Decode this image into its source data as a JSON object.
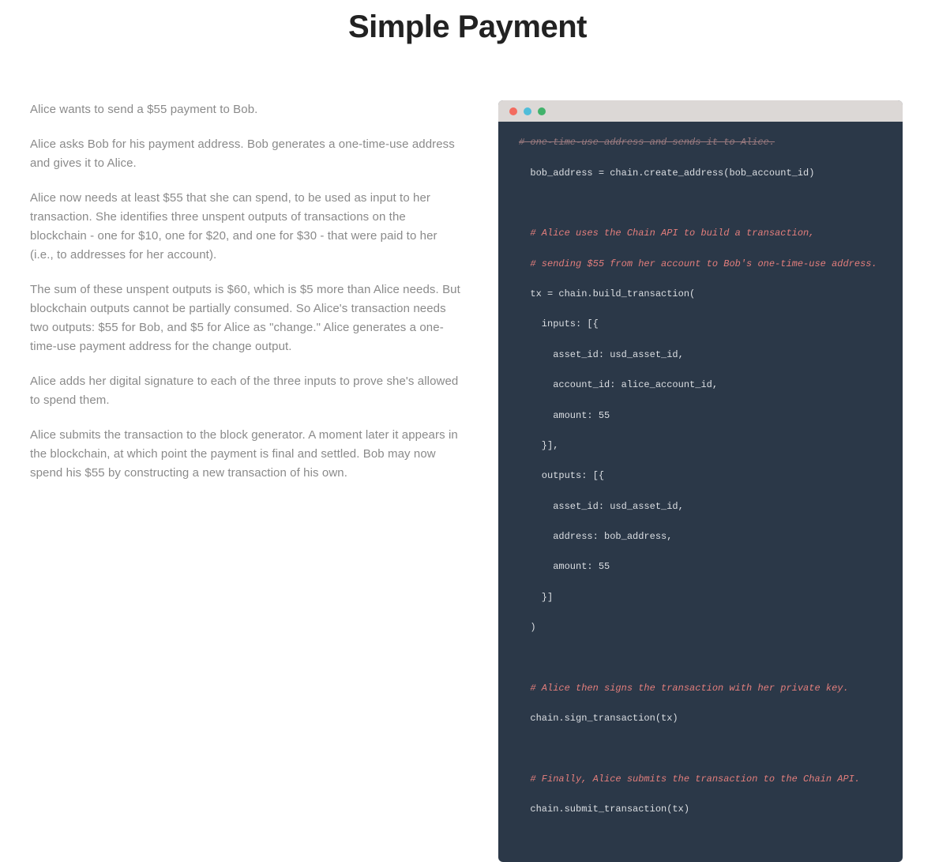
{
  "title": "Simple Payment",
  "paragraphs": [
    "Alice wants to send a $55 payment to Bob.",
    "Alice asks Bob for his payment address. Bob generates a one-time-use address and gives it to Alice.",
    "Alice now needs at least $55 that she can spend, to be used as input to her transaction. She identifies three unspent outputs of transactions on the blockchain - one for $10, one for $20, and one for $30 - that were paid to her (i.e., to addresses for her account).",
    "The sum of these unspent outputs is $60, which is $5 more than Alice needs. But blockchain outputs cannot be partially consumed. So Alice's transaction needs two outputs: $55 for Bob, and $5 for Alice as \"change.\" Alice generates a one-time-use payment address for the change output.",
    "Alice adds her digital signature to each of the three inputs to prove she's allowed to spend them.",
    "Alice submits the transaction to the block generator. A moment later it appears in the blockchain, at which point the payment is final and settled. Bob may now spend his $55 by constructing a new transaction of his own."
  ],
  "code": {
    "line_cut": "# one-time-use address and sends it to Alice.",
    "line1": "  bob_address = chain.create_address(bob_account_id)",
    "blank1": "",
    "comment_build1": "  # Alice uses the Chain API to build a transaction,",
    "comment_build2": "  # sending $55 from her account to Bob's one-time-use address.",
    "tx1": "  tx = chain.build_transaction(",
    "tx2": "    inputs: [{",
    "tx3": "      asset_id: usd_asset_id,",
    "tx4": "      account_id: alice_account_id,",
    "tx5": "      amount: 55",
    "tx6": "    }],",
    "tx7": "    outputs: [{",
    "tx8": "      asset_id: usd_asset_id,",
    "tx9": "      address: bob_address,",
    "tx10": "      amount: 55",
    "tx11": "    }]",
    "tx12": "  )",
    "blank2": "",
    "comment_sign": "  # Alice then signs the transaction with her private key.",
    "sign": "  chain.sign_transaction(tx)",
    "blank3": "",
    "comment_submit": "  # Finally, Alice submits the transaction to the Chain API.",
    "submit": "  chain.submit_transaction(tx)"
  }
}
